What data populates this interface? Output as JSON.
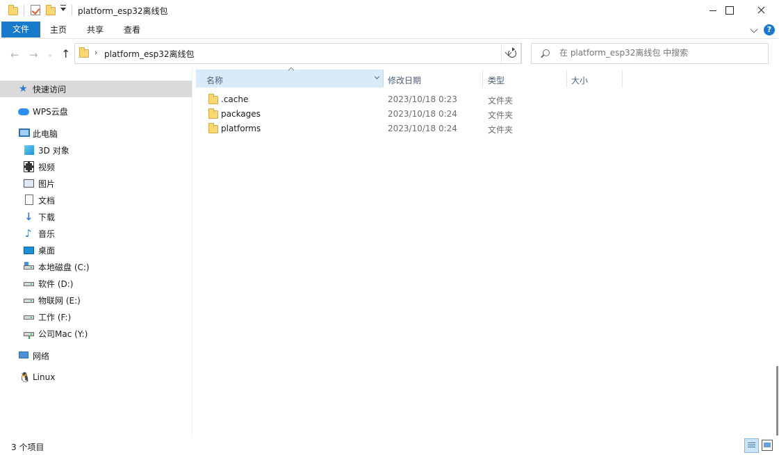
{
  "window": {
    "title": "platform_esp32离线包"
  },
  "ribbon": {
    "tabs": [
      "文件",
      "主页",
      "共享",
      "查看"
    ],
    "help_label": "?"
  },
  "address": {
    "path": "platform_esp32离线包",
    "separator": "›"
  },
  "search": {
    "placeholder": "在 platform_esp32离线包 中搜索"
  },
  "sidebar": {
    "items": [
      {
        "label": "快速访问",
        "icon": "quick-access-star-icon"
      },
      {
        "label": "WPS云盘",
        "icon": "wps-cloud-icon"
      },
      {
        "label": "此电脑",
        "icon": "this-pc-icon"
      },
      {
        "label": "3D 对象",
        "icon": "3d-objects-icon"
      },
      {
        "label": "视频",
        "icon": "videos-icon"
      },
      {
        "label": "图片",
        "icon": "pictures-icon"
      },
      {
        "label": "文档",
        "icon": "documents-icon"
      },
      {
        "label": "下载",
        "icon": "downloads-icon"
      },
      {
        "label": "音乐",
        "icon": "music-icon"
      },
      {
        "label": "桌面",
        "icon": "desktop-icon"
      },
      {
        "label": "本地磁盘 (C:)",
        "icon": "system-drive-icon"
      },
      {
        "label": "软件 (D:)",
        "icon": "drive-icon"
      },
      {
        "label": "物联网 (E:)",
        "icon": "drive-icon"
      },
      {
        "label": "工作 (F:)",
        "icon": "drive-icon"
      },
      {
        "label": "公司Mac (Y:)",
        "icon": "network-drive-icon"
      },
      {
        "label": "网络",
        "icon": "network-icon"
      },
      {
        "label": "Linux",
        "icon": "linux-icon"
      }
    ]
  },
  "columns": {
    "name": "名称",
    "modified": "修改日期",
    "type": "类型",
    "size": "大小"
  },
  "files": [
    {
      "name": ".cache",
      "modified": "2023/10/18 0:23",
      "type": "文件夹"
    },
    {
      "name": "packages",
      "modified": "2023/10/18 0:24",
      "type": "文件夹"
    },
    {
      "name": "platforms",
      "modified": "2023/10/18 0:24",
      "type": "文件夹"
    }
  ],
  "status": {
    "item_count": "3 个项目"
  },
  "colors": {
    "accent": "#1979ca",
    "folder": "#f8d775",
    "selection": "#d9d9d9",
    "header_highlight": "#d9ebf9"
  }
}
